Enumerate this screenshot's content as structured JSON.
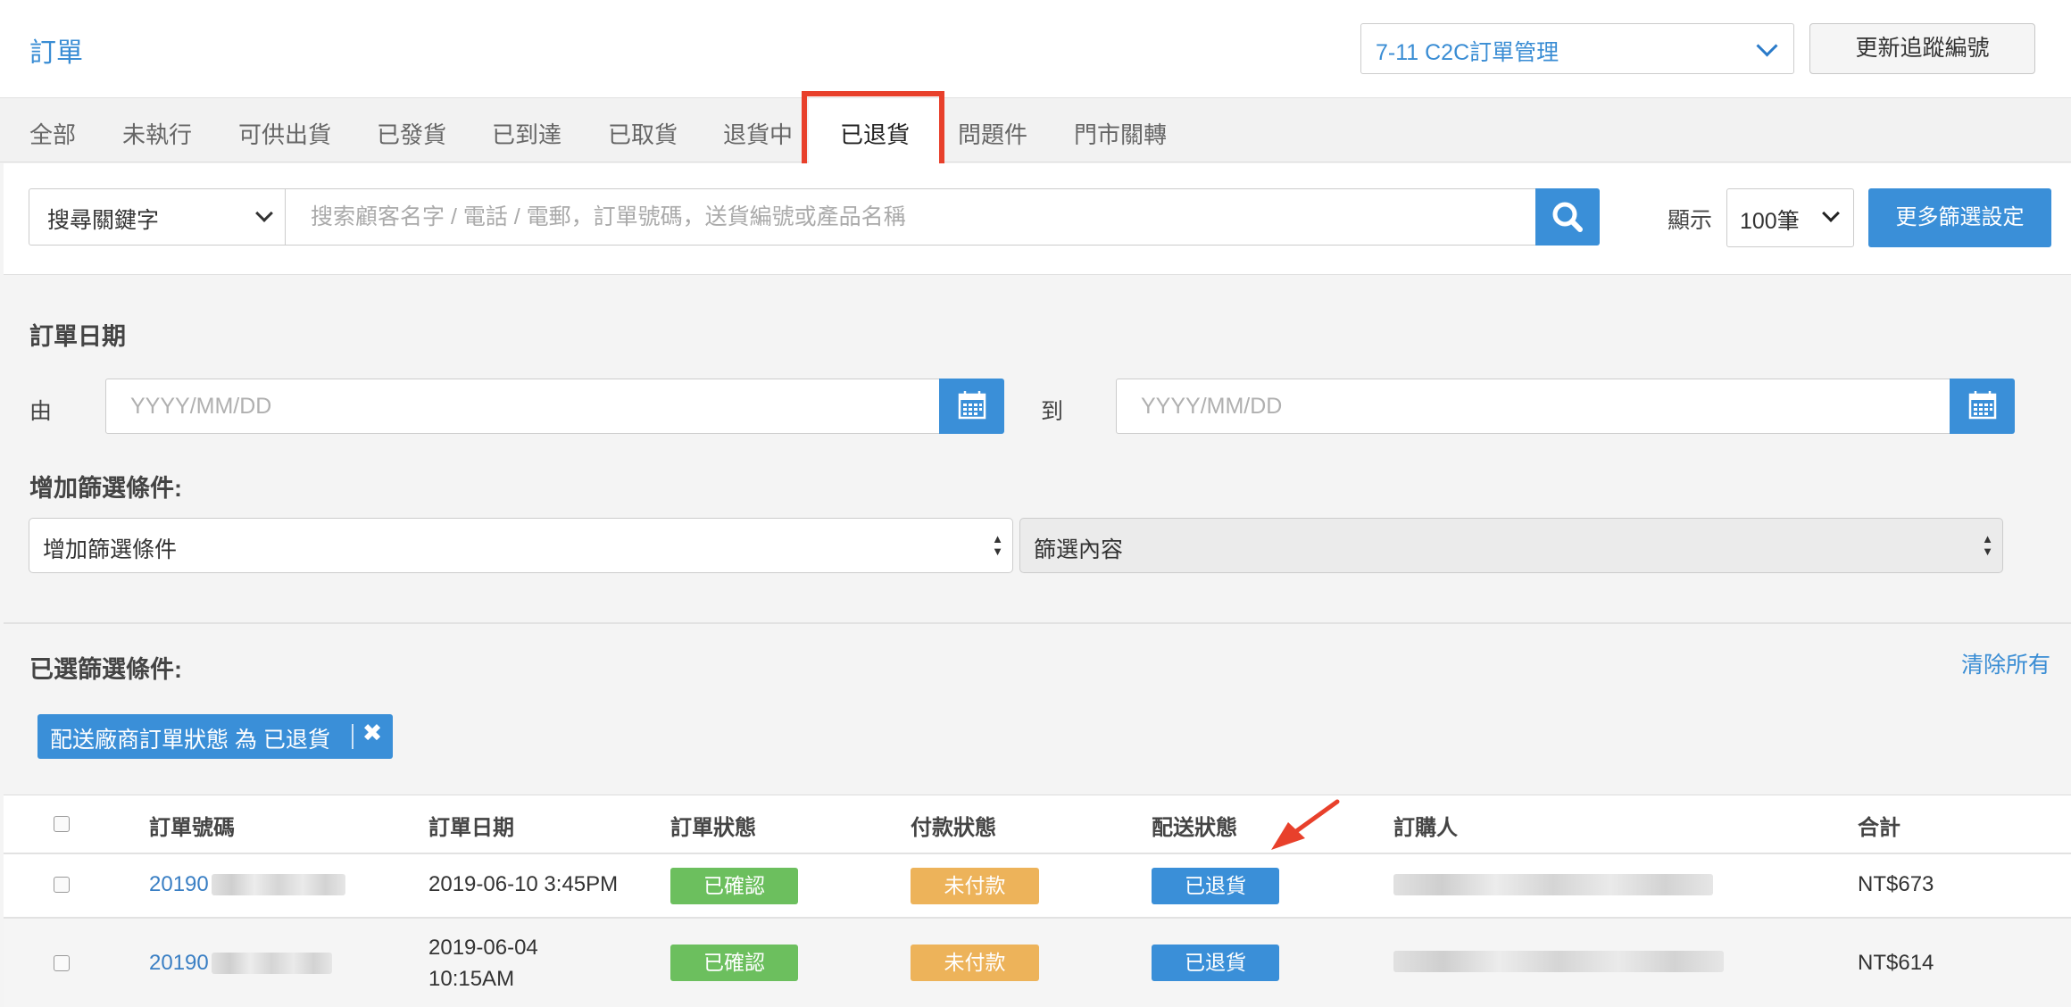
{
  "header": {
    "title": "訂單",
    "store_select": "7-11 C2C訂單管理",
    "update_button": "更新追蹤編號"
  },
  "tabs": [
    {
      "label": "全部"
    },
    {
      "label": "未執行"
    },
    {
      "label": "可供出貨"
    },
    {
      "label": "已發貨"
    },
    {
      "label": "已到達"
    },
    {
      "label": "已取貨"
    },
    {
      "label": "退貨中"
    },
    {
      "label": "已退貨",
      "active": true
    },
    {
      "label": "問題件"
    },
    {
      "label": "門市關轉"
    }
  ],
  "search": {
    "field_select": "搜尋關鍵字",
    "placeholder": "搜索顧客名字 / 電話 / 電郵，訂單號碼，送貨編號或產品名稱",
    "show_label": "顯示",
    "page_size": "100筆",
    "more_filters_button": "更多篩選設定",
    "icon": "search-icon"
  },
  "filters": {
    "order_date_heading": "訂單日期",
    "from_label": "由",
    "to_label": "到",
    "date_placeholder": "YYYY/MM/DD",
    "calendar_icon": "calendar-icon",
    "add_filter_heading": "增加篩選條件:",
    "add_filter_select": "增加篩選條件",
    "filter_content_select": "篩選內容",
    "selected_heading": "已選篩選條件:",
    "clear_all": "清除所有",
    "chip": {
      "label": "配送廠商訂單狀態 為 已退貨",
      "close_icon": "close-icon"
    }
  },
  "table": {
    "columns": [
      "訂單號碼",
      "訂單日期",
      "訂單狀態",
      "付款狀態",
      "配送狀態",
      "訂購人",
      "合計"
    ],
    "rows": [
      {
        "order_no": "20190",
        "date": "2019-06-10 3:45PM",
        "order_status": "已確認",
        "payment_status": "未付款",
        "delivery_status": "已退貨",
        "total": "NT$673"
      },
      {
        "order_no": "20190",
        "date": "2019-06-04",
        "time": "10:15AM",
        "order_status": "已確認",
        "payment_status": "未付款",
        "delivery_status": "已退貨",
        "total": "NT$614"
      }
    ]
  },
  "colors": {
    "accent": "#3a8fd8",
    "link": "#3a8dd4",
    "confirmed": "#6cbf5e",
    "unpaid": "#edb35a",
    "highlight": "#e8402b"
  }
}
